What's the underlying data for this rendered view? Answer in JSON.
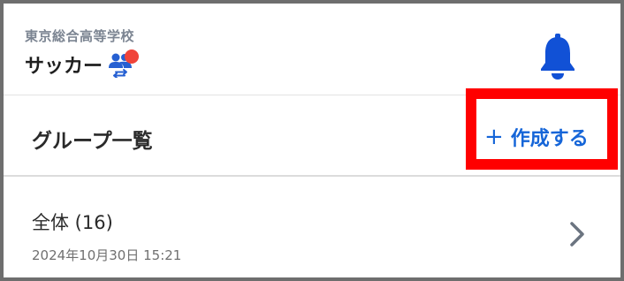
{
  "header": {
    "school_name": "東京総合高等学校",
    "team_name": "サッカー",
    "switch_icon": "team-switch-icon",
    "notification_icon": "bell-icon",
    "colors": {
      "bell": "#1151d6",
      "switch": "#2660d2",
      "badge": "#f0443a"
    }
  },
  "section": {
    "title": "グループ一覧",
    "create_label": "作成する",
    "create_plus": "+",
    "accent": "#1565d8",
    "highlight": "#ff0000"
  },
  "groups": [
    {
      "name": "全体 (16)",
      "updated": "2024年10月30日 15:21",
      "icon": "chevron-right-icon"
    }
  ]
}
